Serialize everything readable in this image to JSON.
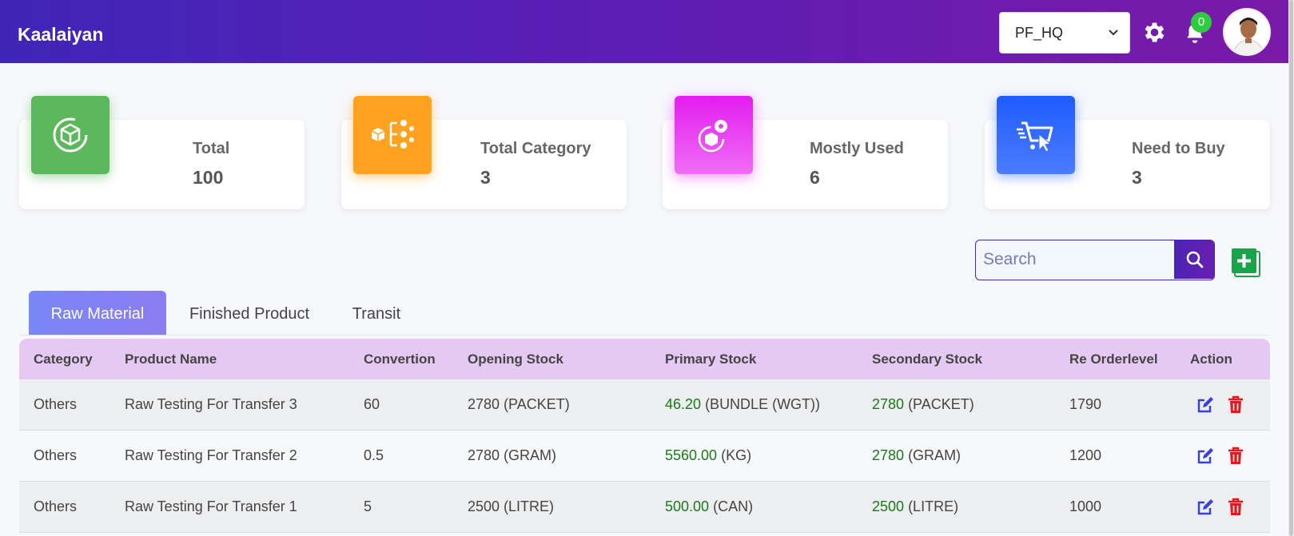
{
  "app": {
    "brand": "Kaalaiyan"
  },
  "header": {
    "location_select": "PF_HQ",
    "notification_count": "0"
  },
  "stats": [
    {
      "title": "Total",
      "value": "100",
      "color": "#5cb85c",
      "icon": "cube-icon"
    },
    {
      "title": "Total Category",
      "value": "3",
      "color": "#ffa21f",
      "icon": "category-boxes-icon"
    },
    {
      "title": "Mostly Used",
      "value": "6",
      "color": "#e842f0",
      "icon": "box-gear-icon"
    },
    {
      "title": "Need to Buy",
      "value": "3",
      "color": "#2f6bff",
      "icon": "cart-icon"
    }
  ],
  "search": {
    "placeholder": "Search",
    "value": ""
  },
  "tabs": [
    {
      "label": "Raw Material",
      "active": true
    },
    {
      "label": "Finished Product",
      "active": false
    },
    {
      "label": "Transit",
      "active": false
    }
  ],
  "table": {
    "headers": [
      "Category",
      "Product Name",
      "Convertion",
      "Opening Stock",
      "Primary Stock",
      "Secondary Stock",
      "Re Orderlevel",
      "Action"
    ],
    "rows": [
      {
        "category": "Others",
        "product": "Raw Testing For Transfer 3",
        "conversion": "60",
        "opening": "2780 (PACKET)",
        "primary_qty": "46.20",
        "primary_unit": "(BUNDLE (WGT))",
        "secondary_qty": "2780",
        "secondary_unit": "(PACKET)",
        "reorder": "1790"
      },
      {
        "category": "Others",
        "product": "Raw Testing For Transfer 2",
        "conversion": "0.5",
        "opening": "2780 (GRAM)",
        "primary_qty": "5560.00",
        "primary_unit": "(KG)",
        "secondary_qty": "2780",
        "secondary_unit": "(GRAM)",
        "reorder": "1200"
      },
      {
        "category": "Others",
        "product": "Raw Testing For Transfer 1",
        "conversion": "5",
        "opening": "2500 (LITRE)",
        "primary_qty": "500.00",
        "primary_unit": "(CAN)",
        "secondary_qty": "2500",
        "secondary_unit": "(LITRE)",
        "reorder": "1000"
      }
    ]
  },
  "colors": {
    "header_start": "#3f26b8",
    "header_end": "#7a1aa8",
    "table_header": "#e4c9f2",
    "stock_green": "#1a7a1a",
    "edit_blue": "#3b3fe0",
    "delete_red": "#e01b1b"
  }
}
